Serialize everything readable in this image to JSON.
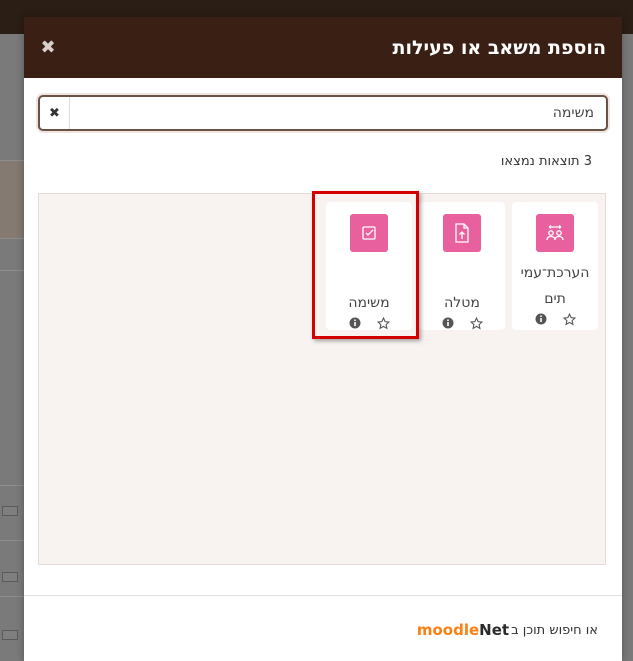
{
  "modal": {
    "title": "הוספת משאב או פעילות",
    "close_icon": "close-icon"
  },
  "search": {
    "value": "משימה",
    "clear_icon": "clear-icon"
  },
  "results": {
    "count_text": "3 תוצאות נמצאו",
    "items": [
      {
        "label_line1": "הערכת־עמי",
        "label_line2": "תים",
        "icon": "peer-assessment-icon"
      },
      {
        "label": "מטלה",
        "icon": "file-upload-icon"
      },
      {
        "label": "משימה",
        "icon": "checkbox-icon",
        "highlighted": true
      }
    ]
  },
  "footer": {
    "text": "או חיפוש תוכן ב",
    "logo_part1": "moodle",
    "logo_part2": "Net"
  },
  "colors": {
    "header": "#3a1f14",
    "activity_icon": "#e8609e",
    "highlight": "#d40000",
    "results_bg": "#f8f3f1"
  }
}
